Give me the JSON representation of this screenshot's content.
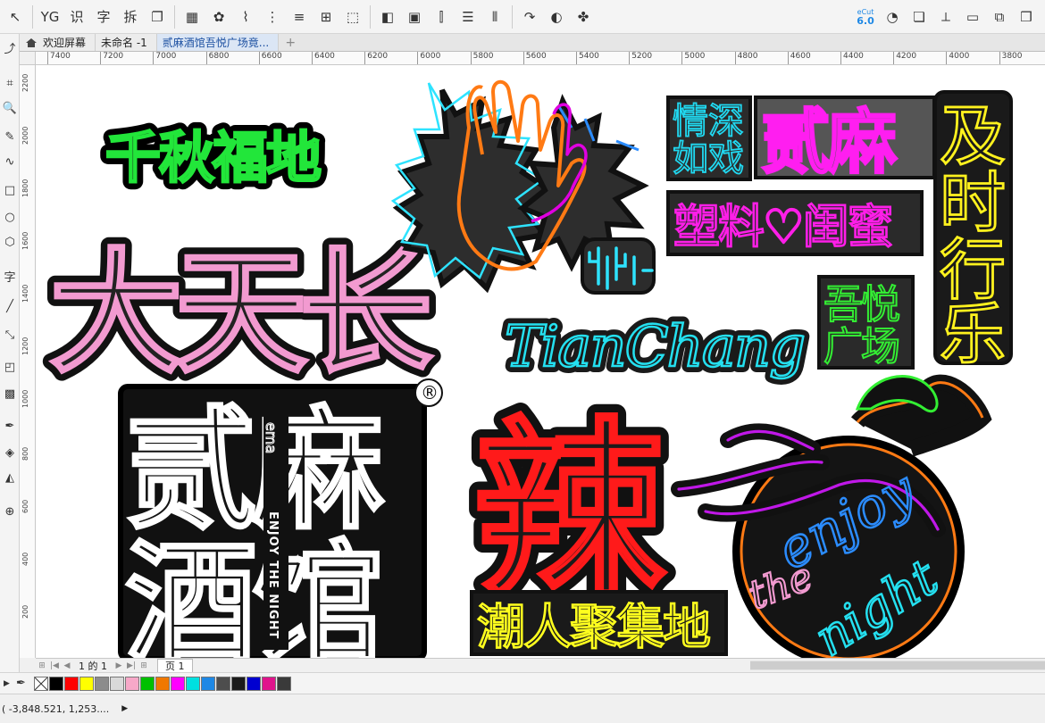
{
  "toolbar": {
    "items": [
      {
        "name": "pick-tool-icon",
        "glyph": "↖"
      },
      {
        "name": "yg-plugin-button",
        "glyph": "YG"
      },
      {
        "name": "recognize-text-button",
        "glyph": "识"
      },
      {
        "name": "text-button",
        "glyph": "字"
      },
      {
        "name": "split-button",
        "glyph": "拆"
      },
      {
        "name": "copy-icon",
        "glyph": "❐"
      },
      {
        "name": "table-icon",
        "glyph": "▦"
      },
      {
        "name": "pattern-icon",
        "glyph": "✿"
      },
      {
        "name": "node-icon",
        "glyph": "⌇"
      },
      {
        "name": "distribute-icon",
        "glyph": "⋮"
      },
      {
        "name": "align-icon",
        "glyph": "≡"
      },
      {
        "name": "group-icon",
        "glyph": "⊞"
      },
      {
        "name": "select-box-icon",
        "glyph": "⬚"
      },
      {
        "name": "shape-color-icon",
        "glyph": "◧"
      },
      {
        "name": "picture-icon",
        "glyph": "▣"
      },
      {
        "name": "dimension-icon",
        "glyph": "⫿"
      },
      {
        "name": "list-icon",
        "glyph": "☰"
      },
      {
        "name": "barcode-icon",
        "glyph": "⦀"
      },
      {
        "name": "arrow-icon",
        "glyph": "↷"
      },
      {
        "name": "sphere-icon",
        "glyph": "◐"
      },
      {
        "name": "puzzle-icon",
        "glyph": "✤"
      }
    ],
    "right_items": [
      {
        "name": "ecut-button",
        "top": "eCut",
        "bottom": "6.0"
      },
      {
        "name": "bucket-icon",
        "glyph": "◔"
      },
      {
        "name": "stack-icon",
        "glyph": "❏"
      },
      {
        "name": "trim-icon",
        "glyph": "⟂"
      },
      {
        "name": "ruler-icon",
        "glyph": "▭"
      },
      {
        "name": "layers-icon",
        "glyph": "⧉"
      },
      {
        "name": "windows-icon",
        "glyph": "❒"
      }
    ]
  },
  "tabs": [
    {
      "label": "欢迎屏幕",
      "active": false,
      "home": true
    },
    {
      "label": "未命名 -1",
      "active": false,
      "home": false
    },
    {
      "label": "贰麻酒馆吾悦广场竟...",
      "active": true,
      "home": false
    }
  ],
  "add_tab": "+",
  "toolbox": [
    {
      "name": "pick-tool-icon",
      "glyph": "↖"
    },
    {
      "name": "shape-tool-icon",
      "glyph": "⤴"
    },
    {
      "name": "crop-tool-icon",
      "glyph": "⌗"
    },
    {
      "name": "zoom-tool-icon",
      "glyph": "🔍"
    },
    {
      "name": "freehand-tool-icon",
      "glyph": "✎"
    },
    {
      "name": "artistic-media-icon",
      "glyph": "∿"
    },
    {
      "name": "rectangle-tool-icon",
      "glyph": "□"
    },
    {
      "name": "ellipse-tool-icon",
      "glyph": "○"
    },
    {
      "name": "polygon-tool-icon",
      "glyph": "⬡"
    },
    {
      "name": "text-tool-icon",
      "glyph": "字"
    },
    {
      "name": "parallel-dimension-icon",
      "glyph": "╱"
    },
    {
      "name": "connector-tool-icon",
      "glyph": "⤡"
    },
    {
      "name": "drop-shadow-icon",
      "glyph": "◰"
    },
    {
      "name": "transparency-icon",
      "glyph": "▩"
    },
    {
      "name": "eyedropper-icon",
      "glyph": "✒"
    },
    {
      "name": "fill-tool-icon",
      "glyph": "◈"
    },
    {
      "name": "smart-fill-icon",
      "glyph": "◭"
    },
    {
      "name": "add-tool-icon",
      "glyph": "⊕"
    }
  ],
  "ruler": {
    "h_ticks": [
      "7400",
      "7200",
      "7000",
      "6800",
      "6600",
      "6400",
      "6200",
      "6000",
      "5800",
      "5600",
      "5400",
      "5200",
      "5000",
      "4800",
      "4600",
      "4400",
      "4200",
      "4000",
      "3800"
    ],
    "v_ticks": [
      "2200",
      "2000",
      "1800",
      "1600",
      "1400",
      "1200",
      "1000",
      "800",
      "600",
      "400",
      "200"
    ]
  },
  "artwork": {
    "qianqiu": "千秋福地",
    "datianchang": "大天长",
    "tianchang": "TianChang",
    "qingshen": "情深",
    "ruxi": "如戏",
    "ermablock": "贰麻",
    "suliao": "塑料♡闺蜜",
    "jishi": [
      "及",
      "时",
      "行",
      "乐"
    ],
    "wuyue": [
      "吾悦",
      "广场"
    ],
    "erma": "贰麻",
    "jiuguan": "酒馆",
    "enjoy_vertical": "ENJOY THE NIGHT",
    "ema_small": "ema",
    "registered": "®",
    "la": "辣",
    "chaoren": "潮人聚集地",
    "enjoy": "enjoy",
    "the": "the",
    "night": "night"
  },
  "pagenav": {
    "count": "1 的 1",
    "page_tab": "页 1"
  },
  "palette": [
    "#000000",
    "#ff0000",
    "#ffff00",
    "#8c8c8c",
    "#d9d9d9",
    "#f7a8c8",
    "#00c000",
    "#f07800",
    "#ff00ff",
    "#00e0e0",
    "#1e88e5",
    "#4d4d4d",
    "#1a1a1a",
    "#0000d0",
    "#e0148c",
    "#3a3a3a"
  ],
  "status": {
    "coords": "( -3,848.521, 1,253....",
    "arrow": "▶"
  }
}
